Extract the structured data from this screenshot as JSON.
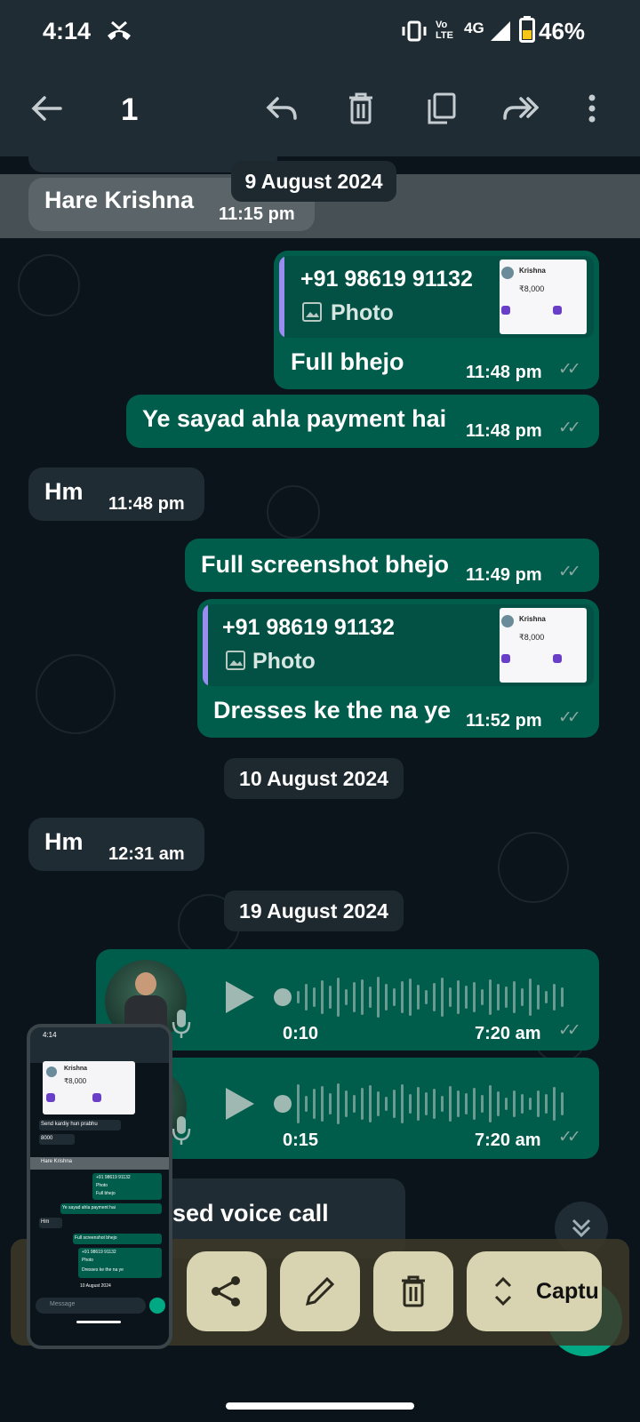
{
  "status": {
    "time": "4:14",
    "network": "4G",
    "volte": "Vo LTE",
    "battery": "46%"
  },
  "app_bar": {
    "selected_count": "1"
  },
  "messages": [
    {
      "text": "Hare Krishna",
      "time": "11:15 pm"
    },
    {
      "quote_sender": "+91 98619 91132",
      "quote_type": "Photo",
      "text": "Full bhejo",
      "time": "11:48 pm"
    },
    {
      "text": "Ye sayad ahla payment hai",
      "time": "11:48 pm"
    },
    {
      "text": "Hm",
      "time": "11:48 pm"
    },
    {
      "text": "Full screenshot bhejo",
      "time": "11:49 pm"
    },
    {
      "quote_sender": "+91 98619 91132",
      "quote_type": "Photo",
      "text": "Dresses ke the na ye",
      "time": "11:52 pm"
    },
    {
      "text": "Hm",
      "time": "12:31 am"
    },
    {
      "duration": "0:10",
      "time": "7:20 am"
    },
    {
      "duration": "0:15",
      "time": "7:20 am"
    },
    {
      "text": "sed voice call"
    }
  ],
  "dates": [
    "9 August 2024",
    "10 August 2024",
    "19 August 2024"
  ],
  "quote_thumb": {
    "name": "Krishna",
    "amount": "₹8,000"
  },
  "preview": {
    "status_time": "4:14",
    "name": "Krishna",
    "amount": "₹8,000",
    "lines": [
      "Send kardiy hun prabhu",
      "8000",
      "Hare Krishna",
      "+91 98619 91132",
      "Photo",
      "Full bhejo",
      "Ye sayad ahla payment hai",
      "Hm",
      "Full screenshot bhejo",
      "+91 98619 91132",
      "Photo",
      "Dresses ke the na ye",
      "10 August 2024"
    ],
    "input_placeholder": "Message"
  },
  "toolbar": {
    "capture_label": "Captu"
  },
  "colors": {
    "outgoing": "#005c4b",
    "incoming": "#202c33",
    "header": "#1f2c34",
    "background": "#0b141a",
    "quote_accent": "#9a8cf0"
  }
}
